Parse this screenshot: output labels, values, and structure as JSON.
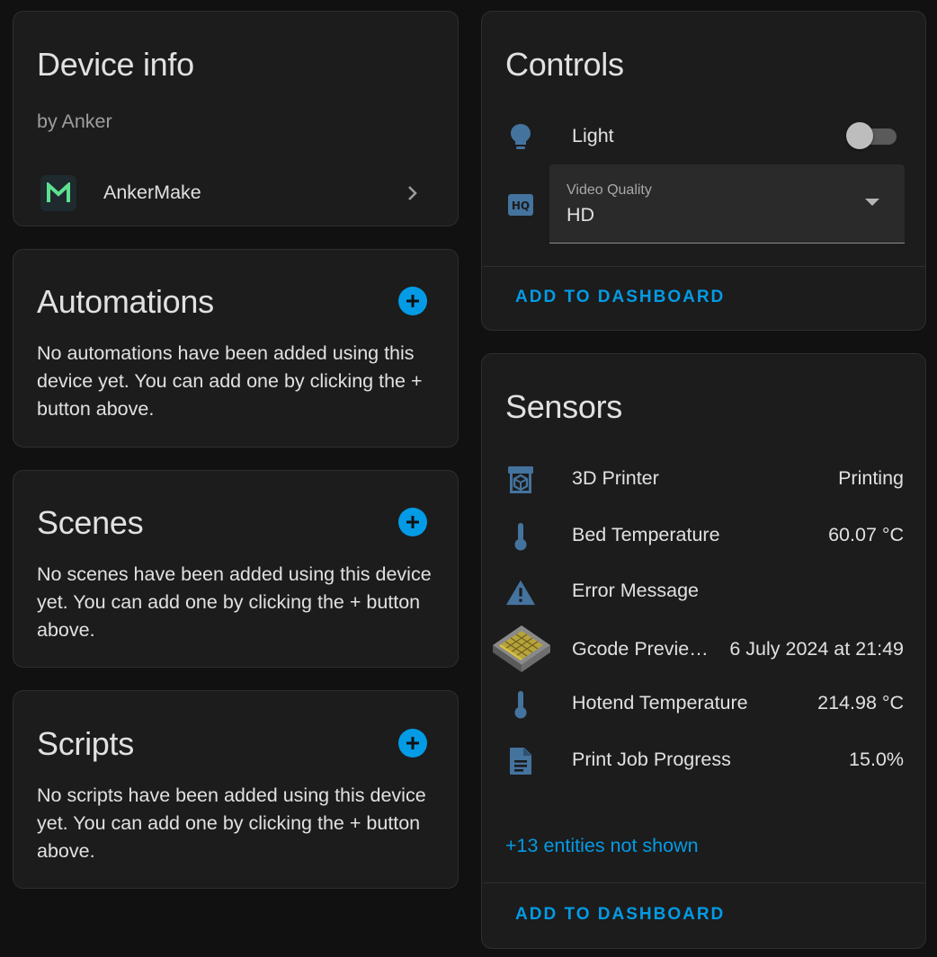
{
  "device_info": {
    "title": "Device info",
    "manufacturer": "by Anker",
    "integration_name": "AnkerMake",
    "logo_letter": "M"
  },
  "automations": {
    "title": "Automations",
    "empty_text": "No automations have been added using this device yet. You can add one by clicking the + button above."
  },
  "scenes": {
    "title": "Scenes",
    "empty_text": "No scenes have been added using this device yet. You can add one by clicking the + button above."
  },
  "scripts": {
    "title": "Scripts",
    "empty_text": "No scripts have been added using this device yet. You can add one by clicking the + button above."
  },
  "controls": {
    "title": "Controls",
    "light": {
      "label": "Light",
      "on": false,
      "icon": "lightbulb-icon"
    },
    "video_quality": {
      "label": "Video Quality",
      "value": "HD",
      "icon": "hq-icon"
    },
    "add_to_dashboard": "ADD TO DASHBOARD"
  },
  "sensors": {
    "title": "Sensors",
    "items": [
      {
        "name": "3D Printer",
        "state": "Printing",
        "icon": "printer-3d-icon"
      },
      {
        "name": "Bed Temperature",
        "state": "60.07 °C",
        "icon": "thermometer-icon"
      },
      {
        "name": "Error Message",
        "state": "",
        "icon": "alert-icon"
      },
      {
        "name": "Gcode Previe…",
        "state": "6 July 2024 at 21:49",
        "icon": "gcode-preview-image"
      },
      {
        "name": "Hotend Temperature",
        "state": "214.98 °C",
        "icon": "thermometer-icon"
      },
      {
        "name": "Print Job Progress",
        "state": "15.0%",
        "icon": "file-document-icon"
      }
    ],
    "more_entities": "+13 entities not shown",
    "add_to_dashboard": "ADD TO DASHBOARD"
  },
  "colors": {
    "background": "#111111",
    "card": "#1c1c1c",
    "accent": "#039be5",
    "icon": "#44739e",
    "logo_bg": "#1e2a2e",
    "logo_fg": "#5ee08f"
  }
}
